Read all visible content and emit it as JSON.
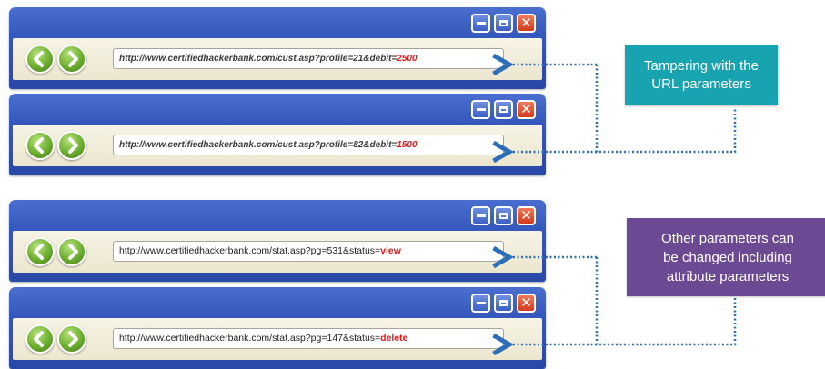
{
  "windows": [
    {
      "url_base": "http://www.certifiedhackerbank.com/cust.asp?profile=21&debit=",
      "url_param": "2500"
    },
    {
      "url_base": "http://www.certifiedhackerbank.com/cust.asp?profile=82&debit=",
      "url_param": "1500"
    },
    {
      "url_base": "http://www.certifiedhackerbank.com/stat.asp?pg=531&status=",
      "url_param": "view"
    },
    {
      "url_base": "http://www.certifiedhackerbank.com/stat.asp?pg=147&status=",
      "url_param": "delete"
    }
  ],
  "callouts": {
    "url_tampering": [
      "Tampering with the",
      "URL parameters"
    ],
    "other_params": [
      "Other parameters can",
      "be changed including",
      "attribute parameters"
    ]
  },
  "colors": {
    "window_frame": "#3558bd",
    "toolbar": "#f1edda",
    "param_highlight": "#e8161a",
    "connector": "#2c6fb7",
    "callout_teal": "#18a3b1",
    "callout_purple": "#6b4a93"
  },
  "icons": {
    "nav_back": "back-arrow-icon",
    "nav_forward": "forward-arrow-icon",
    "minimize": "minimize-icon",
    "maximize": "maximize-icon",
    "close": "close-icon"
  }
}
